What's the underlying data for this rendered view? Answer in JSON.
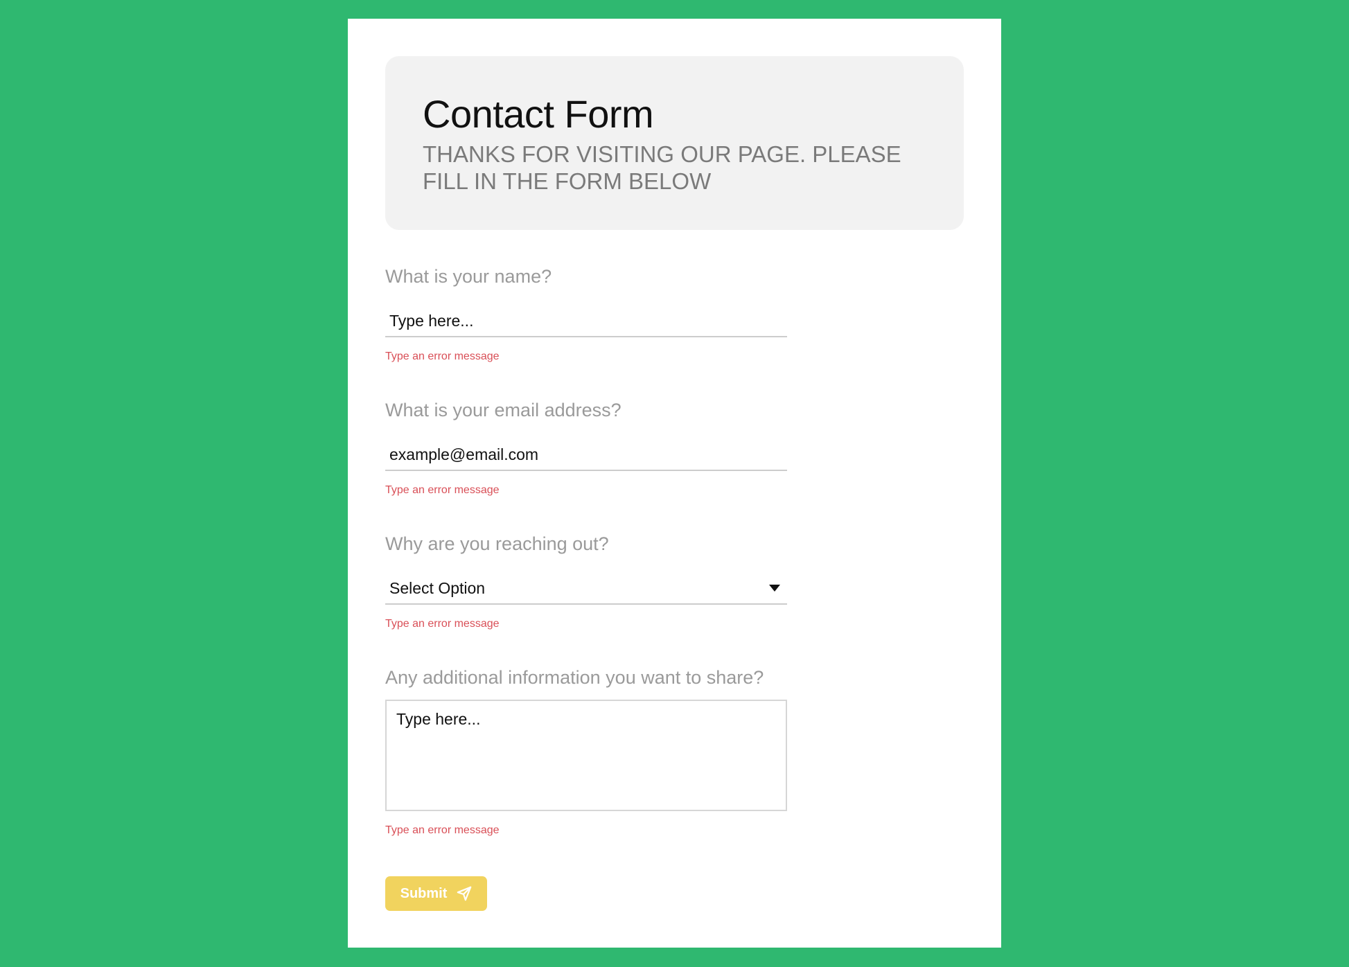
{
  "form": {
    "title": "Contact Form",
    "subtitle": "THANKS FOR VISITING OUR PAGE. PLEASE FILL IN THE FORM BELOW",
    "fields": [
      {
        "question": "What is your name?",
        "value": "Type here...",
        "error": "Type an error message"
      },
      {
        "question": "What is your email address?",
        "value": "example@email.com",
        "error": "Type an error message"
      },
      {
        "question": "Why are you reaching out?",
        "value": "Select Option",
        "error": "Type an error message"
      },
      {
        "question": "Any additional information you want to share?",
        "value": "Type here...",
        "error": "Type an error message"
      }
    ],
    "submit_label": "Submit",
    "submit_icon": "send-icon"
  },
  "colors": {
    "background": "#2fb870",
    "card": "#ffffff",
    "header_box": "#f2f2f2",
    "error": "#d94f57",
    "submit": "#f1d35e"
  }
}
